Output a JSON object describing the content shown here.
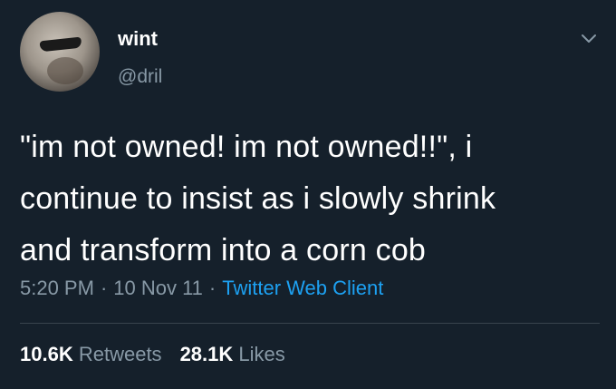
{
  "author": {
    "display_name": "wint",
    "handle": "@dril"
  },
  "tweet": {
    "text": "\"im not owned!  im not owned!!\", i\ncontinue to insist as i slowly shrink\nand transform into a corn cob",
    "time": "5:20 PM",
    "date": "10 Nov 11",
    "client": "Twitter Web Client",
    "separator": "·"
  },
  "stats": {
    "retweets_count": "10.6K",
    "retweets_label": "Retweets",
    "likes_count": "28.1K",
    "likes_label": "Likes"
  },
  "icons": {
    "menu": "chevron-down-icon"
  },
  "colors": {
    "background": "#15202b",
    "primary_text": "#ffffff",
    "secondary_text": "#8899a6",
    "link": "#1da1f2",
    "divider": "#38444d"
  }
}
